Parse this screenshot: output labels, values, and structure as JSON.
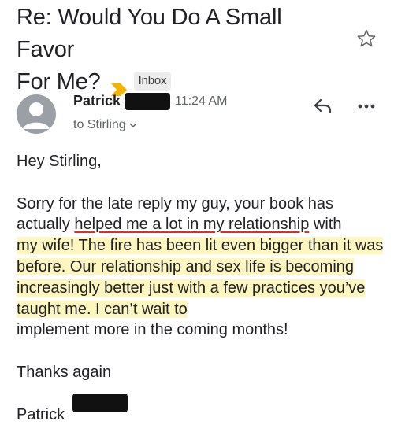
{
  "email": {
    "subject_line1": "Re: Would You Do A Small Favor",
    "subject_line2": "For Me?",
    "label": "Inbox",
    "sender_name": "Patrick",
    "time": "11:24 AM",
    "to": "to Stirling",
    "greeting": "Hey Stirling,",
    "body_part1": "Sorry for the late reply my guy, your book has actually ",
    "body_underlined": "helped me a lot in my relationship",
    "body_part2_line": " with",
    "body_highlight": "my wife! The fire has been lit even bigger than it was before. Our relationship and sex life is becoming increasingly better just with a few practices you’ve taught me. I can’t wait to",
    "body_end": "implement more in the coming months!",
    "closing": "Thanks again",
    "signature": "Patrick"
  },
  "icons": [
    "important-arrow-icon",
    "star-icon",
    "avatar-icon",
    "reply-icon",
    "more-icon",
    "chevron-down-icon"
  ],
  "colors": {
    "highlight": "#fdf7bf",
    "underline": "#d93025",
    "important_arrow": "#f4b400"
  }
}
